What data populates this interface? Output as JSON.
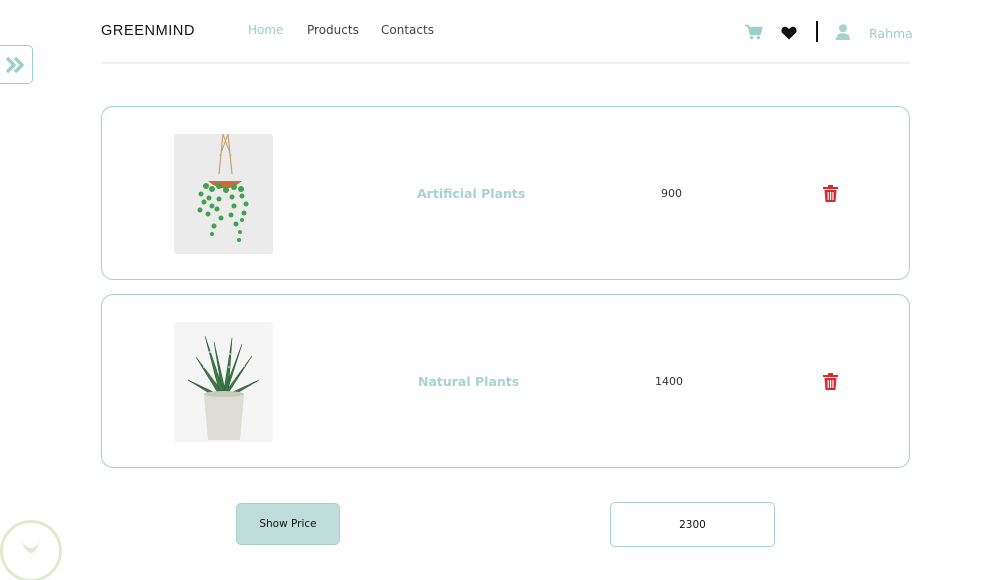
{
  "navbar": {
    "brand": "GREENMIND",
    "links": [
      {
        "label": "Home",
        "active": true
      },
      {
        "label": "Products",
        "active": false
      },
      {
        "label": "Contacts",
        "active": false
      }
    ],
    "username": "Rahma",
    "icons": [
      "cart-icon",
      "heart-icon",
      "user-icon"
    ]
  },
  "cart_items": [
    {
      "name": "Artificial Plants",
      "price": "900",
      "image": "hanging-plant-image",
      "action_icon": "trash-icon"
    },
    {
      "name": "Natural Plants",
      "price": "1400",
      "image": "potted-succulent-image",
      "action_icon": "trash-icon"
    }
  ],
  "summary": {
    "show_price_label": "Show Price",
    "total": "2300"
  },
  "colors": {
    "accent": "#9ccfc8",
    "border": "#a8d2cc",
    "button_bg": "#bedddb",
    "delete": "#e0262a",
    "text": "#333333"
  }
}
